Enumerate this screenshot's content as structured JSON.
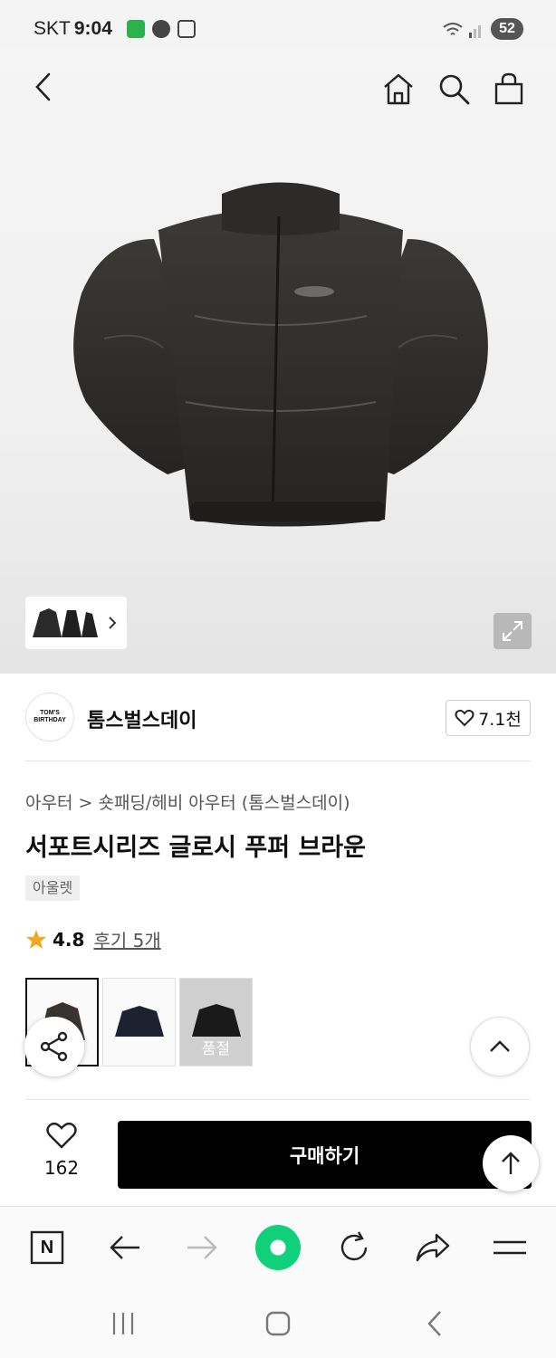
{
  "status_bar": {
    "carrier": "SKT",
    "time": "9:04",
    "battery": "52"
  },
  "colors": {
    "buy_button_bg": "#000000",
    "star": "#f2a81d",
    "browser_green": "#10d17a"
  },
  "header": {
    "icons": [
      "back-icon",
      "home-icon",
      "search-icon",
      "cart-icon"
    ]
  },
  "product": {
    "brand_logo_text": [
      "TOM'S",
      "BIRTHDAY"
    ],
    "brand": "톰스벌스데이",
    "brand_likes": "7.1천",
    "breadcrumb_root": "아우터",
    "breadcrumb_sep": ">",
    "breadcrumb_sub": "숏패딩/헤비 아우터 (톰스벌스데이)",
    "title": "서포트시리즈 글로시 푸퍼 브라운",
    "tag": "아울렛",
    "rating": "4.8",
    "reviews": "후기 5개",
    "variants": [
      {
        "label": "",
        "selected": true
      },
      {
        "label": "",
        "selected": false
      },
      {
        "label": "품절",
        "selected": false
      }
    ]
  },
  "buy_bar": {
    "likes": "162",
    "buy_label": "구매하기"
  },
  "browser_toolbar": {
    "naver_label": "N"
  }
}
